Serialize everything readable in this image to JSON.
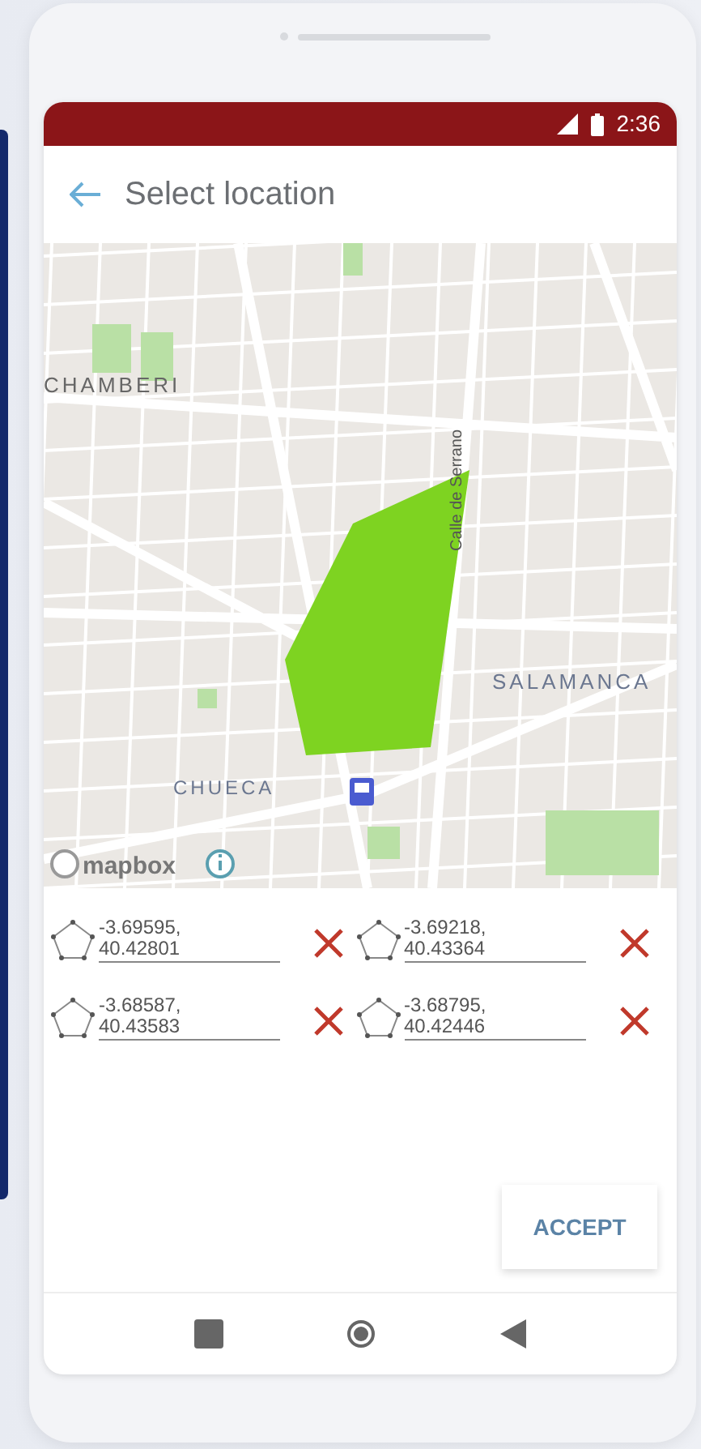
{
  "status_bar": {
    "time": "2:36"
  },
  "app_bar": {
    "title": "Select location"
  },
  "map": {
    "labels": [
      {
        "text": "CHAMBERI"
      },
      {
        "text": "SALAMANCA"
      },
      {
        "text": "CHUECA"
      },
      {
        "text": "Calle de Serrano"
      }
    ],
    "attribution": "mapbox"
  },
  "points": [
    {
      "value": "-3.69595, 40.42801"
    },
    {
      "value": "-3.69218, 40.43364"
    },
    {
      "value": "-3.68587, 40.43583"
    },
    {
      "value": "-3.68795, 40.42446"
    }
  ],
  "accept_button": {
    "label": "ACCEPT"
  }
}
